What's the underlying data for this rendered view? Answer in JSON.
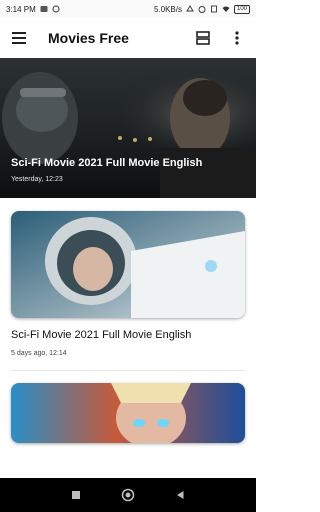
{
  "status_bar": {
    "time": "3:14 PM",
    "network_speed": "5.0KB/s",
    "battery": "100",
    "icons": [
      "notification-icon",
      "settings-icon",
      "mute-icon",
      "alarm-icon",
      "sim-icon",
      "wifi-icon",
      "battery-icon"
    ]
  },
  "app_bar": {
    "title": "Movies Free",
    "icons": [
      "menu-icon",
      "view-toggle-icon",
      "more-vert-icon"
    ]
  },
  "hero": {
    "title": "Sci-Fi Movie 2021 Full Movie English",
    "timestamp": "Yesterday, 12:23"
  },
  "cards": [
    {
      "title": "Sci-Fi Movie 2021 Full Movie English",
      "timestamp": "5 days ago, 12:14"
    }
  ],
  "nav_bar": {
    "icons": [
      "recents-square-icon",
      "home-circle-icon",
      "back-triangle-icon"
    ]
  }
}
